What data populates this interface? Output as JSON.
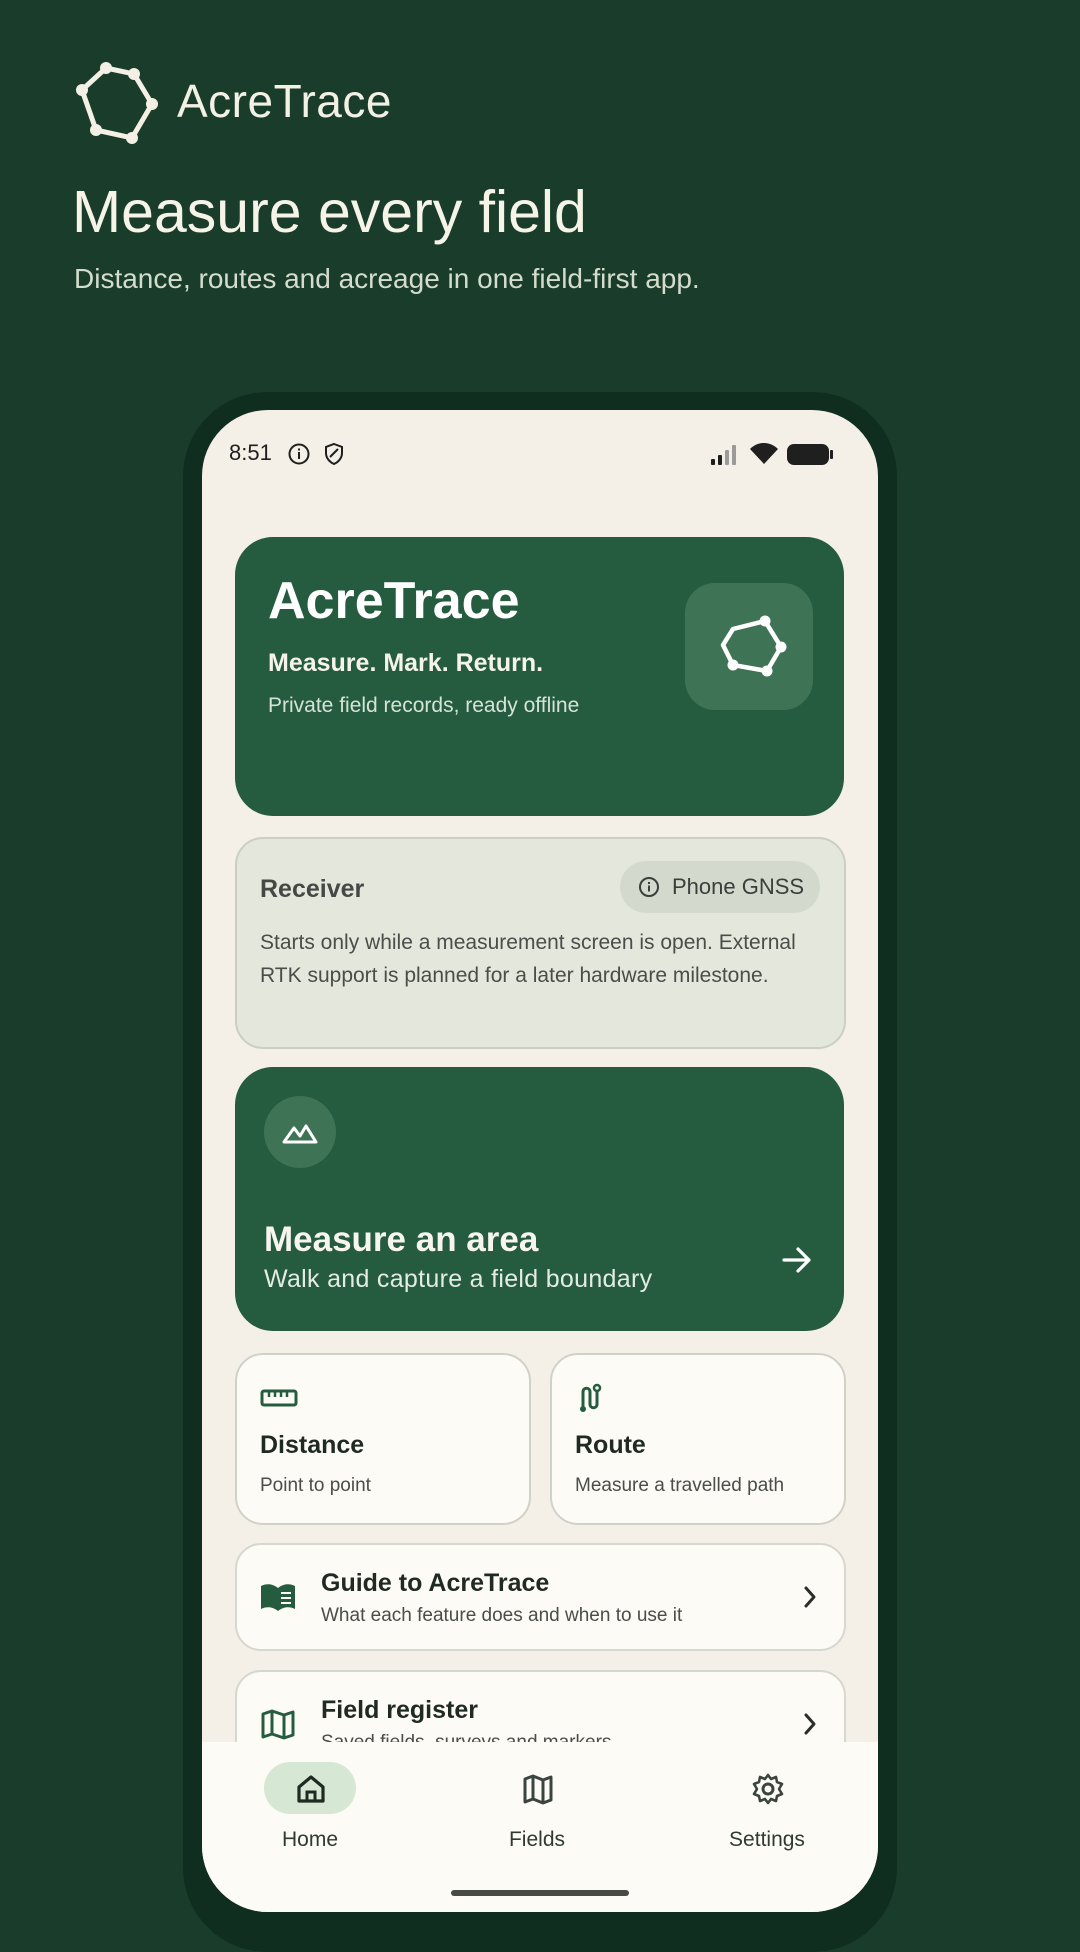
{
  "brand": {
    "name": "AcreTrace"
  },
  "marketing": {
    "headline": "Measure every field",
    "subhead": "Distance, routes and acreage in one field-first app."
  },
  "status_bar": {
    "time": "8:51",
    "icons": [
      "info-icon",
      "shield-icon",
      "signal-icon",
      "wifi-icon",
      "battery-icon"
    ]
  },
  "hero": {
    "title": "AcreTrace",
    "tagline": "Measure. Mark. Return.",
    "description": "Private field records, ready offline",
    "icon": "polygon-logo-icon"
  },
  "receiver": {
    "title": "Receiver",
    "chip_label": "Phone GNSS",
    "body": "Starts only while a measurement screen is open. External RTK support is planned for a later hardware milestone."
  },
  "measure_area": {
    "icon": "terrain-icon",
    "title": "Measure an area",
    "subtitle": "Walk and capture a field boundary"
  },
  "tiles": [
    {
      "icon": "ruler-icon",
      "title": "Distance",
      "subtitle": "Point to point"
    },
    {
      "icon": "route-icon",
      "title": "Route",
      "subtitle": "Measure a travelled path"
    }
  ],
  "rows": [
    {
      "icon": "book-icon",
      "title": "Guide to AcreTrace",
      "subtitle": "What each feature does and when to use it"
    },
    {
      "icon": "map-icon",
      "title": "Field register",
      "subtitle": "Saved fields, surveys and markers"
    }
  ],
  "nav": {
    "active": "Home",
    "items": [
      {
        "label": "Home",
        "icon": "home-icon"
      },
      {
        "label": "Fields",
        "icon": "map-icon"
      },
      {
        "label": "Settings",
        "icon": "gear-icon"
      }
    ]
  },
  "colors": {
    "background": "#193d2a",
    "primary": "#255c40",
    "surface": "#f4f0e7",
    "card": "#fdfbf5",
    "active_pill": "#d6e8d3"
  }
}
